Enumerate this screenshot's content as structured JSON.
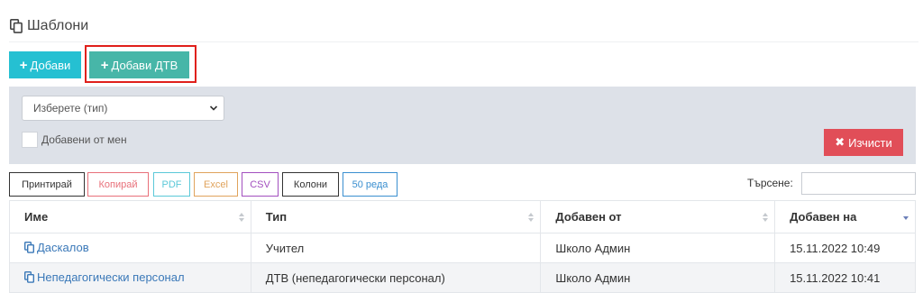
{
  "page": {
    "title": "Шаблони"
  },
  "actions": {
    "add_label": "Добави",
    "add_dtv_label": "Добави ДТВ"
  },
  "filters": {
    "type_select_value": "Изберете (тип)",
    "added_by_me_label": "Добавени от мен",
    "clear_label": "Изчисти"
  },
  "toolbar": {
    "print": "Принтирай",
    "copy": "Копирай",
    "pdf": "PDF",
    "excel": "Excel",
    "csv": "CSV",
    "columns": "Колони",
    "rows": "50 реда",
    "search_label": "Търсене:",
    "search_value": ""
  },
  "table": {
    "headers": [
      "Име",
      "Тип",
      "Добавен от",
      "Добавен на"
    ],
    "rows": [
      [
        "Даскалов",
        "Учител",
        "Школо Админ",
        "15.11.2022 10:49"
      ],
      [
        "Непедагогически персонал",
        "ДТВ (непедагогически персонал)",
        "Школо Админ",
        "15.11.2022 10:41"
      ]
    ]
  },
  "colors": {
    "add": "#25c0d2",
    "add_dtv": "#47b6a8",
    "highlight": "#e0201b",
    "clear": "#e14e58",
    "copy": "#e8707a",
    "pdf": "#5bc8d8",
    "excel": "#e0a35c",
    "csv": "#a24fbf",
    "rows": "#3a8fd0",
    "link": "#3a78b8"
  },
  "icons": [
    "copy-icon",
    "plus-icon",
    "times-icon",
    "chevron-down-icon",
    "sort-icon",
    "sort-desc-icon"
  ]
}
